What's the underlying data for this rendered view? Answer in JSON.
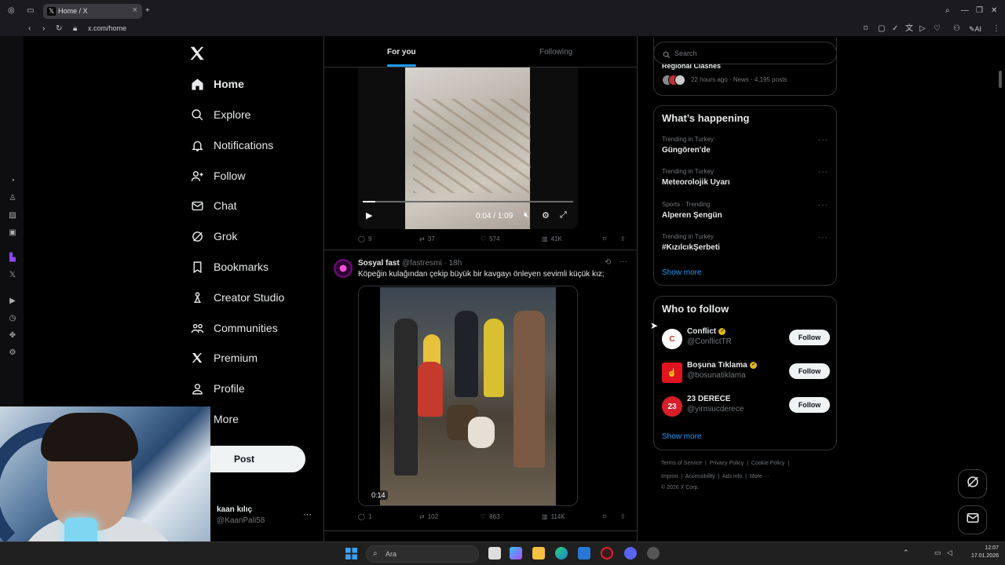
{
  "browser": {
    "tab_title": "Home / X",
    "url": "x.com/home"
  },
  "nav": {
    "items": [
      {
        "label": "Home",
        "icon": "home-icon"
      },
      {
        "label": "Explore",
        "icon": "search-icon"
      },
      {
        "label": "Notifications",
        "icon": "bell-icon"
      },
      {
        "label": "Follow",
        "icon": "person-add-icon"
      },
      {
        "label": "Chat",
        "icon": "mail-icon"
      },
      {
        "label": "Grok",
        "icon": "grok-icon"
      },
      {
        "label": "Bookmarks",
        "icon": "bookmark-icon"
      },
      {
        "label": "Creator Studio",
        "icon": "creator-icon"
      },
      {
        "label": "Communities",
        "icon": "communities-icon"
      },
      {
        "label": "Premium",
        "icon": "x-logo-icon"
      },
      {
        "label": "Profile",
        "icon": "profile-icon"
      },
      {
        "label": "More",
        "icon": "more-circle-icon"
      }
    ],
    "post_label": "Post",
    "account": {
      "name": "kaan kılıç",
      "handle": "@KaanPali58"
    }
  },
  "feed": {
    "tabs": {
      "for_you": "For you",
      "following": "Following"
    },
    "tweet1": {
      "video_time": "0:04 / 1:09",
      "video_progress": 0.06,
      "replies": "9",
      "reposts": "37",
      "likes": "574",
      "views": "41K"
    },
    "tweet2": {
      "name": "Sosyal fast",
      "handle": "@fastresmi · 18h",
      "text": "Köpeğin kulağından çekip büyük bir kavgayı önleyen sevimli küçük kız;",
      "video_time": "0:14",
      "replies": "1",
      "reposts": "102",
      "likes": "863",
      "views": "114K"
    }
  },
  "sidebar": {
    "search_placeholder": "Search",
    "news": {
      "title": "Regional Clashes",
      "meta": "22 hours ago · News · 4,195 posts"
    },
    "happening": {
      "title": "What’s happening",
      "trends": [
        {
          "context": "Trending in Turkey",
          "name": "Güngören'de"
        },
        {
          "context": "Trending in Turkey",
          "name": "Meteorolojik Uyarı"
        },
        {
          "context": "Sports · Trending",
          "name": "Alperen Şengün"
        },
        {
          "context": "Trending in Turkey",
          "name": "#KızılcıkŞerbeti"
        }
      ],
      "show_more": "Show more"
    },
    "who_to_follow": {
      "title": "Who to follow",
      "accounts": [
        {
          "name": "Conflict",
          "handle": "@ConflictTR",
          "avatar": "C",
          "avatar_color": "#ffffff"
        },
        {
          "name": "Boşuna Tıklama",
          "handle": "@bosunatiklama",
          "avatar": "☝",
          "avatar_color": "#e0151f"
        },
        {
          "name": "23 DERECE",
          "handle": "@yirmiucderece",
          "avatar": "23",
          "avatar_color": "#d81e28"
        }
      ],
      "follow_label": "Follow",
      "show_more": "Show more"
    },
    "footer": {
      "links": [
        "Terms of Service",
        "Privacy Policy",
        "Cookie Policy",
        "Imprint",
        "Accessibility",
        "Ads info",
        "More ···"
      ],
      "copyright": "© 2026 X Corp."
    }
  },
  "taskbar": {
    "search_label": "Ara",
    "time": "12:07",
    "date": "17.01.2026"
  },
  "colors": {
    "accent": "#1d9bf0",
    "background": "#000000",
    "border": "#2f3336",
    "muted": "#71767b"
  }
}
